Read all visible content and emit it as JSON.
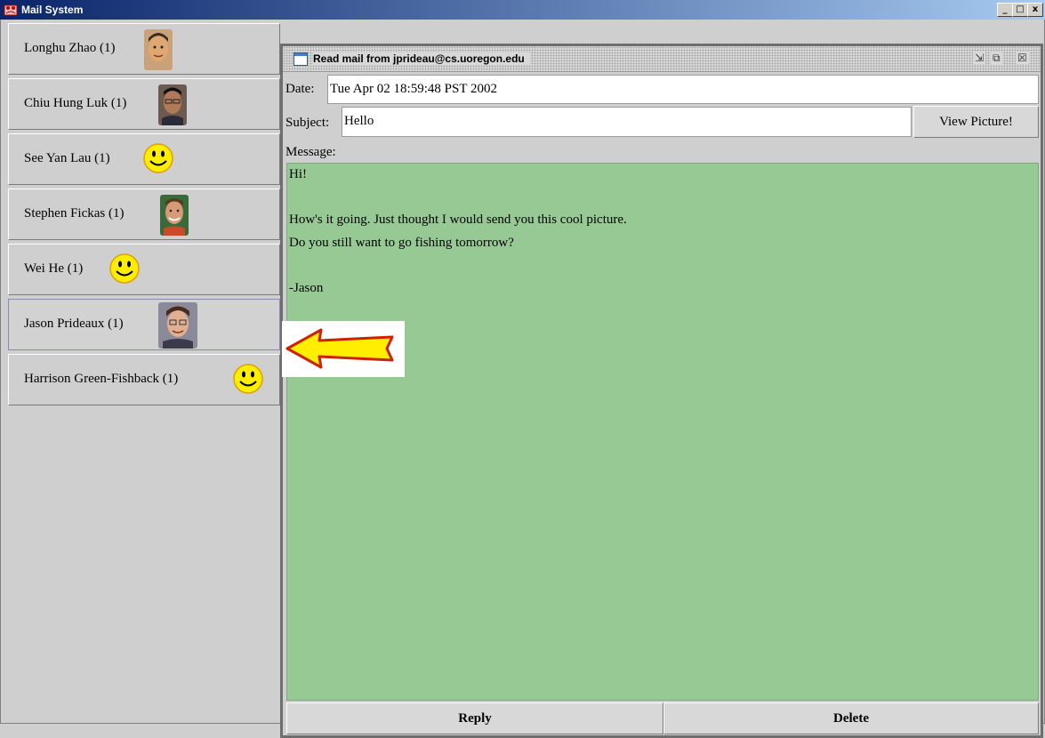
{
  "window": {
    "title": "Mail System",
    "minimize": "_",
    "maximize": "□",
    "close": "x"
  },
  "contacts": [
    {
      "label": "Longhu Zhao (1)",
      "icon": "photo-icon"
    },
    {
      "label": "Chiu Hung Luk (1)",
      "icon": "photo-icon"
    },
    {
      "label": "See Yan Lau (1)",
      "icon": "smiley-icon"
    },
    {
      "label": "Stephen Fickas (1)",
      "icon": "photo-icon"
    },
    {
      "label": "Wei He (1)",
      "icon": "smiley-icon"
    },
    {
      "label": "Jason Prideaux (1)",
      "icon": "photo-icon",
      "selected": true
    },
    {
      "label": "Harrison Green-Fishback (1)",
      "icon": "smiley-icon"
    }
  ],
  "mail": {
    "title": "Read mail from jprideau@cs.uoregon.edu",
    "date_label": "Date:",
    "date_value": "Tue Apr 02 18:59:48 PST 2002",
    "subject_label": "Subject:",
    "subject_value": "Hello",
    "view_picture": "View Picture!",
    "message_label": "Message:",
    "message_lines": [
      "Hi!",
      "",
      "How's it going. Just thought I would send you this cool picture.",
      "Do you still want to go fishing tomorrow?",
      "",
      "-Jason"
    ],
    "reply": "Reply",
    "delete": "Delete"
  },
  "colors": {
    "message_bg": "#97c995",
    "titlebar_start": "#0a246a",
    "arrow_fill": "#ffee00",
    "arrow_outline": "#cc2200"
  }
}
